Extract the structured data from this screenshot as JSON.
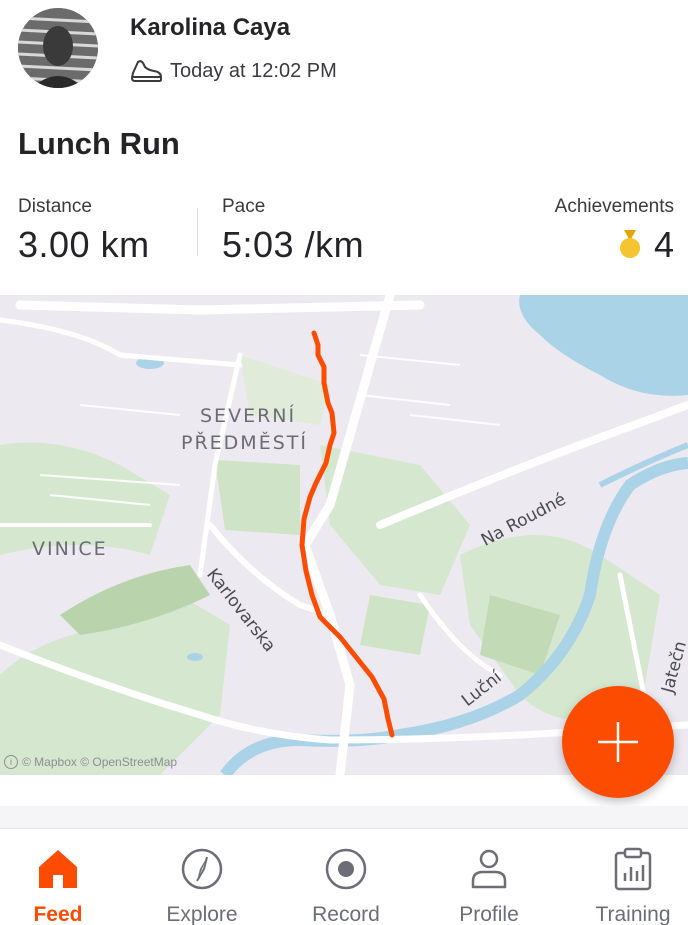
{
  "header": {
    "athlete_name": "Karolina Caya",
    "timestamp": "Today at 12:02 PM",
    "activity_icon": "shoe-icon"
  },
  "activity": {
    "title": "Lunch Run"
  },
  "stats": {
    "distance": {
      "label": "Distance",
      "value": "3.00 km"
    },
    "pace": {
      "label": "Pace",
      "value": "5:03 /km"
    },
    "achievements": {
      "label": "Achievements",
      "count": "4",
      "icon": "medal-icon"
    }
  },
  "map": {
    "labels": {
      "severni": "SEVERNÍ",
      "predmesti": "PŘEDMĚSTÍ",
      "vinice": "VINICE"
    },
    "streets": {
      "karlovarska": "Karlovarska",
      "na_roudne": "Na Roudné",
      "lucni": "Luční",
      "jatecni": "Jatečn"
    },
    "attribution": "© Mapbox © OpenStreetMap",
    "route_color": "#fc4c02"
  },
  "fab": {
    "icon": "plus-icon",
    "color": "#fc4c02"
  },
  "tabs": [
    {
      "label": "Feed",
      "icon": "home-icon",
      "active": true
    },
    {
      "label": "Explore",
      "icon": "compass-icon",
      "active": false
    },
    {
      "label": "Record",
      "icon": "record-icon",
      "active": false
    },
    {
      "label": "Profile",
      "icon": "person-icon",
      "active": false
    },
    {
      "label": "Training",
      "icon": "clipboard-chart-icon",
      "active": false
    }
  ],
  "colors": {
    "accent": "#fc4c02",
    "text": "#242428",
    "muted": "#6d6d78"
  }
}
